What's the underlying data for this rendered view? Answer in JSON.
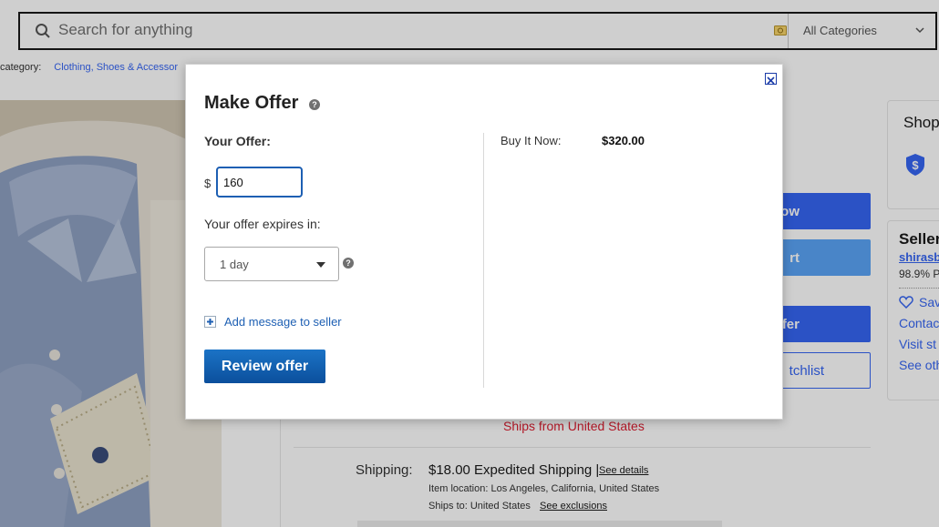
{
  "search": {
    "placeholder": "Search for anything",
    "category": "All Categories"
  },
  "breadcrumb": {
    "label": "category:",
    "link": "Clothing, Shoes & Accessor"
  },
  "actions": {
    "buy_now": "ow",
    "add_to_cart": "rt",
    "make_offer": "fer",
    "watchlist": "tchlist"
  },
  "shipping": {
    "ships_from": "Ships from United States",
    "label": "Shipping:",
    "price": "$18.00",
    "method": "Expedited Shipping |",
    "see_details": "See details",
    "item_location": "Item location:  Los Angeles, California, United States",
    "ships_to": "Ships to:  United States",
    "see_exclusions": "See exclusions"
  },
  "shop_card": {
    "title": "Shop"
  },
  "seller": {
    "title": "Seller",
    "name": "shirasb",
    "feedback": "98.9% P",
    "save": "Sav",
    "contact": "Contac",
    "visit_store": "Visit st",
    "see_other": "See oth"
  },
  "dialog": {
    "title": "Make Offer",
    "your_offer_label": "Your Offer:",
    "currency_symbol": "$",
    "offer_value": "160",
    "expires_label": "Your offer expires in:",
    "expires_value": "1 day",
    "add_message": "Add message to seller",
    "review_button": "Review offer",
    "buy_it_now_label": "Buy It Now:",
    "buy_it_now_price": "$320.00",
    "help_glyph": "?"
  },
  "colors": {
    "accent": "#3665f3",
    "review_button": "#0b4f9c",
    "ships_from": "#dd1e31"
  },
  "icons": [
    "search-icon",
    "camera-icon",
    "chevron-down-icon",
    "shield-icon",
    "heart-icon",
    "close-icon",
    "help-icon",
    "plus-icon"
  ]
}
